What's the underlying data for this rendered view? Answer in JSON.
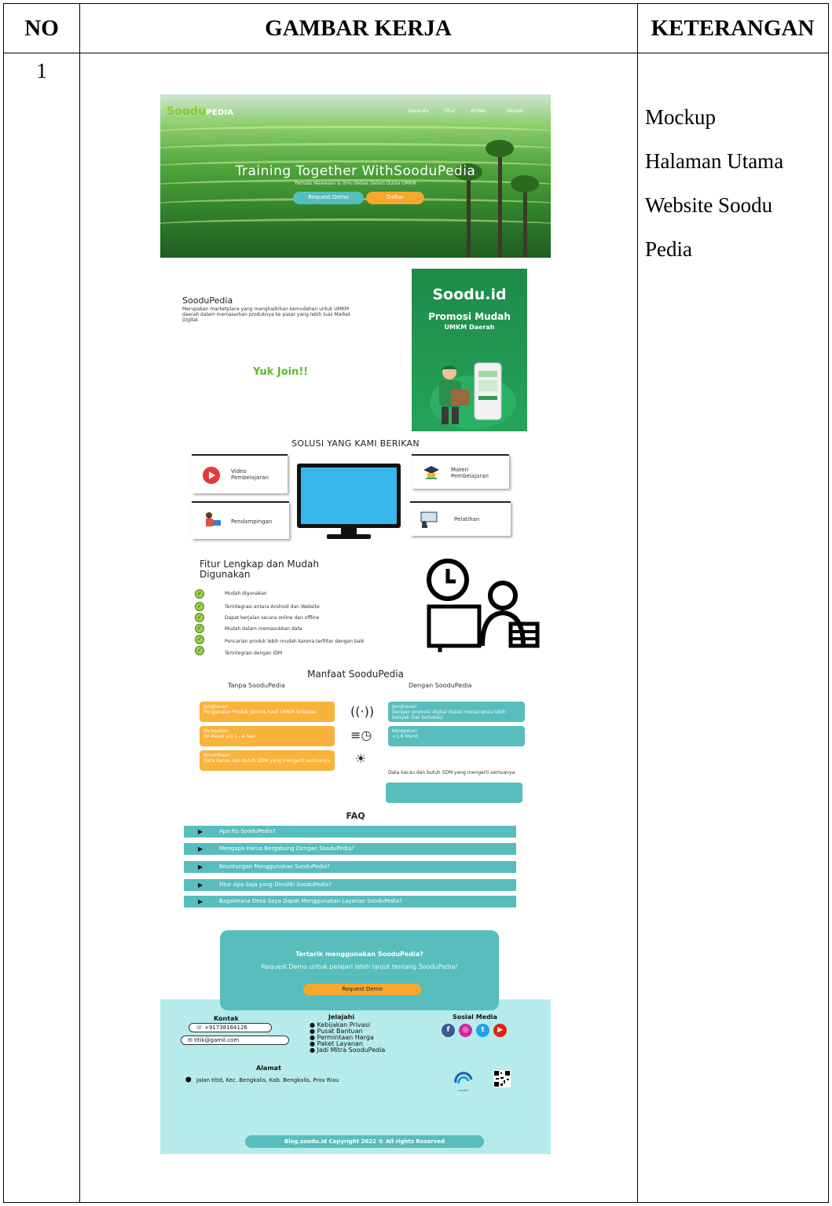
{
  "table": {
    "headers": {
      "no": "NO",
      "gambar": "GAMBAR KERJA",
      "keterangan": "KETERANGAN"
    },
    "row": {
      "no": "1",
      "keterangan": [
        "Mockup",
        "Halaman Utama",
        "Website Soodu",
        "Pedia"
      ]
    }
  },
  "mockup": {
    "hero": {
      "logo_main": "Soodu",
      "logo_suffix": "PEDIA",
      "nav": [
        "Beranda",
        "Fitur",
        "Artikel",
        "Kontak"
      ],
      "title": "Training Together WithSooduPedia",
      "subtitle": "Perluas Wawasan & Ilmu Bebas dalam Dunia UMKM",
      "demo_button": "Request Demo",
      "daftar_button": "Daftar"
    },
    "about": {
      "title": "SooduPedia",
      "description": "Merupakan marketplace yang menghadirkan kemudahan untuk UMKM daerah dalam memasarkan produknya ke pasar yang lebih luas Market Digital.",
      "join": "Yuk Join!!",
      "promo_brand": "Soodu.id",
      "promo_line1": "Promosi Mudah",
      "promo_line2": "UMKM Daerah"
    },
    "solusi": {
      "title": "SOLUSI YANG KAMI BERIKAN",
      "cards": [
        "Video Pembelajaran",
        "Materi Pembelajaran",
        "Pendampingan",
        "Pelatihan"
      ]
    },
    "fitur": {
      "title": "Fitur Lengkap dan Mudah Digunakan",
      "items": [
        "Mudah digunakan",
        "Terintegrasi antara Android dan Website",
        "Dapat berjalan secara online dan offline",
        "Mudah dalam memasukkan data",
        "Pencarian produk lebih mudah karena terfilter dengan baik",
        "Terintegrasi dengan IDM"
      ]
    },
    "manfaat": {
      "title": "Manfaat SooduPedia",
      "tanpa_label": "Tanpa SooduPedia",
      "dengan_label": "Dengan SooduPedia",
      "tanpa": [
        {
          "title": "Jangkauan",
          "text": "Pengenalan Produk precuk hasil UMKM terbatas"
        },
        {
          "title": "Kecepatan",
          "text": "30 Menit s/d 1 - 4 hari"
        },
        {
          "title": "Kecerdasan",
          "text": "Data kacau dan butuh SDM yang mengerti semuanya"
        }
      ],
      "dengan": [
        {
          "title": "Jangkauan",
          "text": "Dengan promosi digital dapat menjangkau lebih banyak (tak terbatas)"
        },
        {
          "title": "Kecepatan",
          "text": "<1.8 Menit"
        }
      ],
      "note": "Data kacau dan butuh SDM yang mengerti semuanya"
    },
    "faq": {
      "title": "FAQ",
      "items": [
        "Apa Itu SooduPedia?",
        "Mengapa Harus Bergabung Dengan SooduPedia?",
        "Keuntungan Menggunakan SooduPedia?",
        "Fitur Apa Saja yang Dimiliki SooduPedia?",
        "Bagaimana Desa Saya Dapat Menggunakan Layanan SooduPedia?"
      ]
    },
    "cta": {
      "title": "Tertarik menggunakan SooduPedia?",
      "subtitle": "Request Demo untuk pelajari lebih lanjut tentang SooduPedia!",
      "button": "Request Demo"
    },
    "footer": {
      "kontak_title": "Kontak",
      "phone": "+91738164126",
      "email": "titik@gamil.com",
      "jelajahi_title": "Jelajahi",
      "jelajahi": [
        "Kebijakan Privasi",
        "Pusat Bantuan",
        "Permintaan Harga",
        "Paket Layanan",
        "Jadi Mitra SooduPedia"
      ],
      "sosial_title": "Sosial Media",
      "alamat_title": "Alamat",
      "alamat": "Jalan titid, Kec. Bengkalis, Kab. Bengkalis, Prov Riau",
      "kominfo": "KOMINFO",
      "copyright": "Blog.soodu.id Copyright 2022 © All rights Reserved"
    },
    "icons": [
      "phone-icon",
      "mail-icon",
      "facebook-icon",
      "instagram-icon",
      "twitter-icon",
      "youtube-icon",
      "location-pin-icon",
      "qr-code-icon",
      "clock-icon",
      "play-icon"
    ],
    "colors": {
      "teal": "#58bdbd",
      "orange": "#f7a72b",
      "green": "#5cb82e",
      "footer_bg": "#b5eceb"
    }
  }
}
